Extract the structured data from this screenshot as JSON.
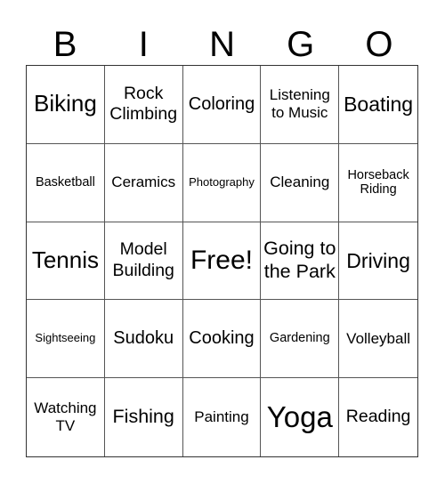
{
  "header": {
    "letters": [
      "B",
      "I",
      "N",
      "G",
      "O"
    ]
  },
  "grid": {
    "cells": [
      "Biking",
      "Rock Climbing",
      "Coloring",
      "Listening to Music",
      "Boating",
      "Basketball",
      "Ceramics",
      "Photography",
      "Cleaning",
      "Horseback Riding",
      "Tennis",
      "Model Building",
      "Free!",
      "Going to the Park",
      "Driving",
      "Sightseeing",
      "Sudoku",
      "Cooking",
      "Gardening",
      "Volleyball",
      "Watching TV",
      "Fishing",
      "Painting",
      "Yoga",
      "Reading"
    ]
  }
}
